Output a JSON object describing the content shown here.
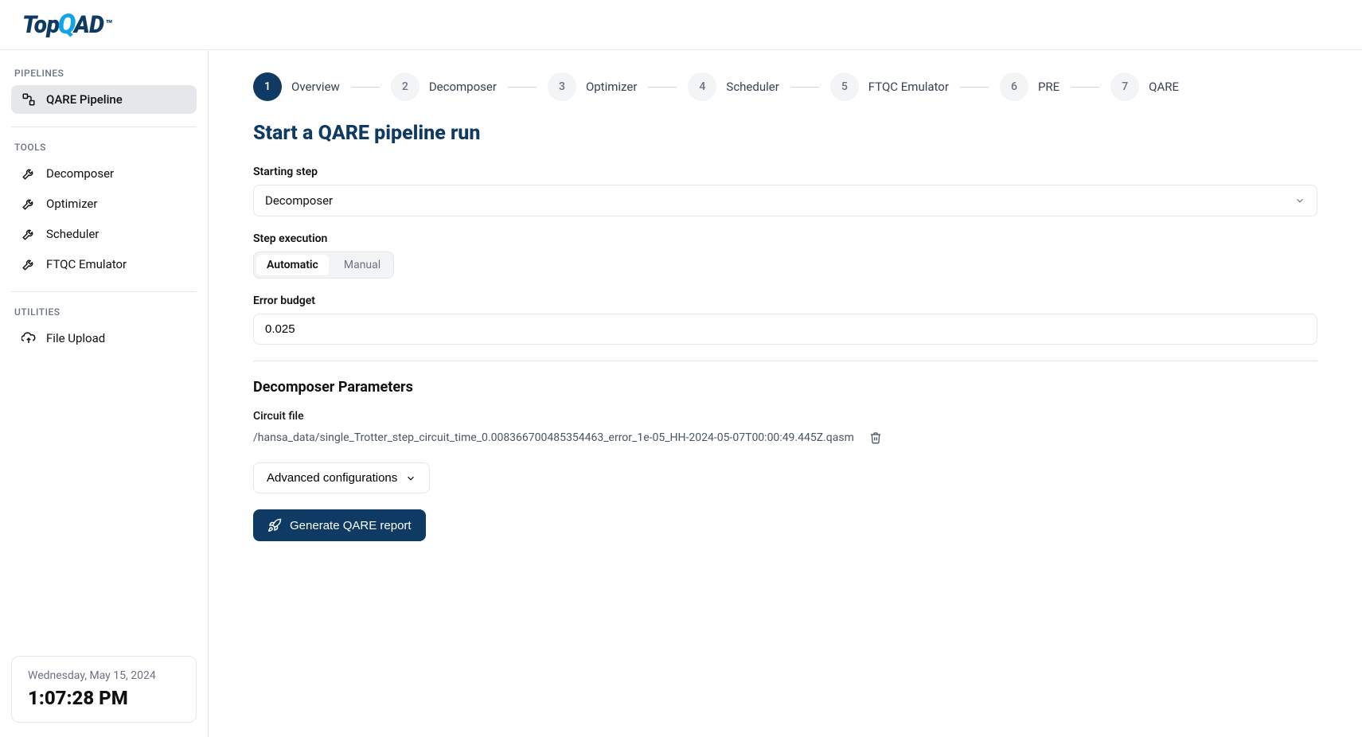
{
  "brand": {
    "pre": "Top",
    "q": "Q",
    "post": "AD",
    "tm": "™"
  },
  "sidebar": {
    "sections": {
      "pipelines": {
        "label": "PIPELINES"
      },
      "tools": {
        "label": "TOOLS"
      },
      "utilities": {
        "label": "UTILITIES"
      }
    },
    "pipelines": [
      {
        "label": "QARE Pipeline"
      }
    ],
    "tools": [
      {
        "label": "Decomposer"
      },
      {
        "label": "Optimizer"
      },
      {
        "label": "Scheduler"
      },
      {
        "label": "FTQC Emulator"
      }
    ],
    "utilities": [
      {
        "label": "File Upload"
      }
    ]
  },
  "clock": {
    "date": "Wednesday, May 15, 2024",
    "time": "1:07:28 PM"
  },
  "stepper": [
    {
      "num": "1",
      "label": "Overview",
      "active": true
    },
    {
      "num": "2",
      "label": "Decomposer",
      "active": false
    },
    {
      "num": "3",
      "label": "Optimizer",
      "active": false
    },
    {
      "num": "4",
      "label": "Scheduler",
      "active": false
    },
    {
      "num": "5",
      "label": "FTQC Emulator",
      "active": false
    },
    {
      "num": "6",
      "label": "PRE",
      "active": false
    },
    {
      "num": "7",
      "label": "QARE",
      "active": false
    }
  ],
  "page": {
    "title": "Start a QARE pipeline run",
    "starting_step_label": "Starting step",
    "starting_step_value": "Decomposer",
    "step_execution_label": "Step execution",
    "exec_options": {
      "automatic": "Automatic",
      "manual": "Manual"
    },
    "error_budget_label": "Error budget",
    "error_budget_value": "0.025",
    "decomposer_params_title": "Decomposer Parameters",
    "circuit_file_label": "Circuit file",
    "circuit_file_path": "/hansa_data/single_Trotter_step_circuit_time_0.008366700485354463_error_1e-05_HH-2024-05-07T00:00:49.445Z.qasm",
    "advanced_label": "Advanced configurations",
    "generate_label": "Generate QARE report"
  }
}
